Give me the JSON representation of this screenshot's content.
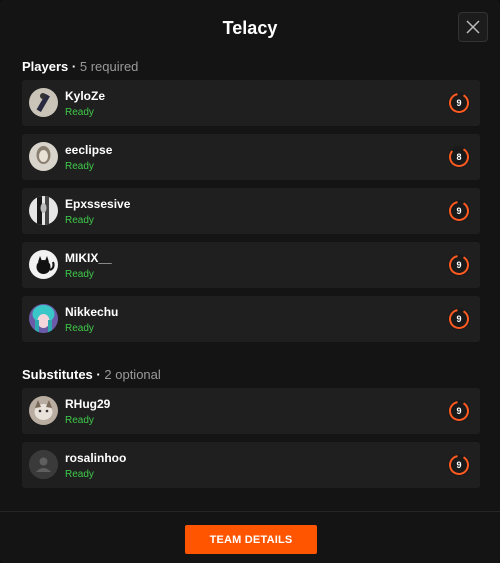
{
  "modal": {
    "title": "Telacy",
    "close_icon": "close-icon"
  },
  "players_section": {
    "label": "Players",
    "separator": "·",
    "note": "5 required"
  },
  "players": [
    {
      "name": "KyloZe",
      "status": "Ready",
      "level": "9",
      "avatar_icon": "avatar-icon"
    },
    {
      "name": "eeclipse",
      "status": "Ready",
      "level": "8",
      "avatar_icon": "avatar-icon"
    },
    {
      "name": "Epxssesive",
      "status": "Ready",
      "level": "9",
      "avatar_icon": "avatar-icon"
    },
    {
      "name": "MIKIX__",
      "status": "Ready",
      "level": "9",
      "avatar_icon": "avatar-icon"
    },
    {
      "name": "Nikkechu",
      "status": "Ready",
      "level": "9",
      "avatar_icon": "avatar-icon"
    }
  ],
  "subs_section": {
    "label": "Substitutes",
    "separator": "·",
    "note": "2 optional"
  },
  "substitutes": [
    {
      "name": "RHug29",
      "status": "Ready",
      "level": "9",
      "avatar_icon": "avatar-icon"
    },
    {
      "name": "rosalinhoo",
      "status": "Ready",
      "level": "9",
      "avatar_icon": "default-avatar-icon"
    }
  ],
  "footer": {
    "team_details_label": "TEAM DETAILS"
  },
  "colors": {
    "accent": "#ff5500",
    "ready": "#3fcb4a",
    "row_bg": "#1f1f1f",
    "modal_bg": "#141414"
  }
}
